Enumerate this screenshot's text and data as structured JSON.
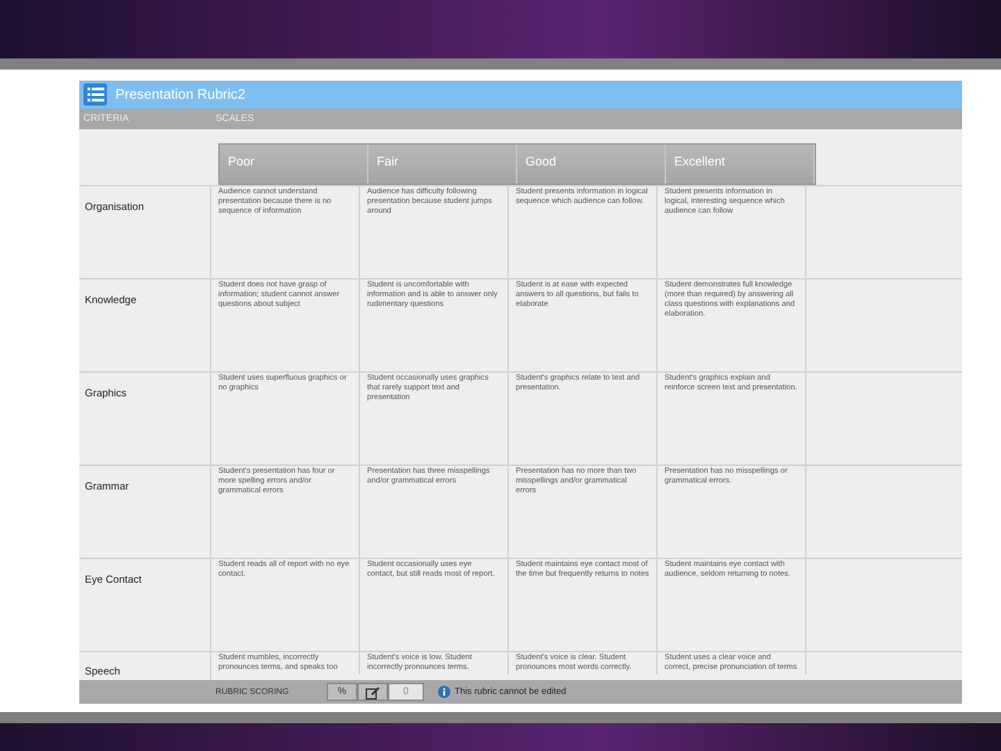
{
  "window": {
    "title": "Presentation Rubric2"
  },
  "header": {
    "criteria": "CRITERIA",
    "scales": "SCALES"
  },
  "scales": [
    "Poor",
    "Fair",
    "Good",
    "Excellent"
  ],
  "rows": [
    {
      "name": "Organisation",
      "cells": [
        "Audience cannot understand presentation because there is no sequence of information",
        "Audience has difficulty following presentation because student jumps around",
        "Student presents information in logical sequence which audience can follow.",
        "Student presents information in logical, interesting sequence which audience can follow"
      ]
    },
    {
      "name": "Knowledge",
      "cells": [
        "Student does not have grasp of information; student cannot answer questions about subject",
        "Student is uncomfortable with information and is able to answer only rudimentary questions",
        "Student is at ease with expected answers to all questions, but fails to elaborate",
        "Student demonstrates full knowledge (more than required) by answering all class questions with explanations and elaboration."
      ]
    },
    {
      "name": "Graphics",
      "cells": [
        "Student uses superfluous graphics or no graphics",
        "Student occasionally uses graphics that rarely support text and presentation",
        "Student's graphics relate to text and presentation.",
        "Student's graphics explain and reinforce screen text and presentation."
      ]
    },
    {
      "name": "Grammar",
      "cells": [
        "Student's presentation has four or more spelling errors and/or grammatical errors",
        "Presentation has three misspellings and/or grammatical errors",
        "Presentation has no more than two misspellings and/or grammatical errors",
        "Presentation has no misspellings or grammatical errors."
      ]
    },
    {
      "name": "Eye Contact",
      "cells": [
        "Student reads all of report with no eye contact.",
        "Student occasionally uses eye contact, but still reads most of report.",
        "Student maintains eye contact most of the time but frequently returns to notes",
        "Student maintains eye contact with audience, seldom returning to notes."
      ]
    },
    {
      "name": "Speech",
      "cells": [
        "Student mumbles, incorrectly pronounces terms, and speaks too",
        "Student's voice is low. Student incorrectly pronounces terms.",
        "Student's voice is clear. Student pronounces most words correctly.",
        "Student uses a clear voice and correct, precise pronunciation of terms"
      ]
    }
  ],
  "footer": {
    "label": "RUBRIC SCORING",
    "percent": "%",
    "score": "0",
    "notice": "This rubric cannot be edited"
  }
}
